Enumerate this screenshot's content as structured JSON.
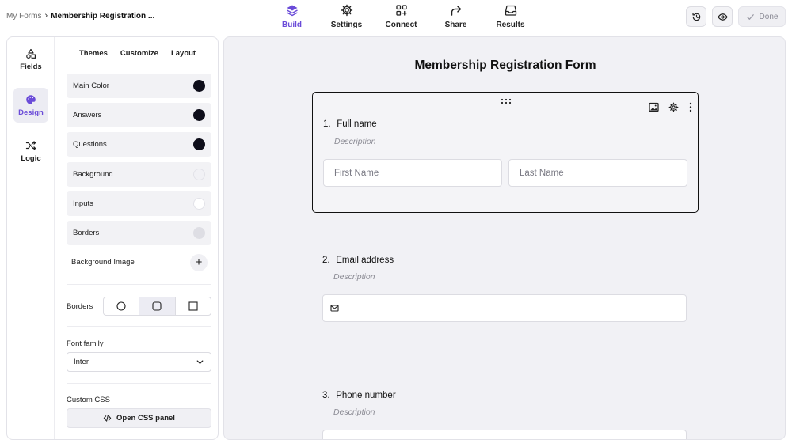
{
  "breadcrumb": {
    "root": "My Forms",
    "separator": "›",
    "current": "Membership Registration ..."
  },
  "nav": [
    {
      "label": "Build",
      "icon": "layers-icon",
      "active": true
    },
    {
      "label": "Settings",
      "icon": "gear-icon",
      "active": false
    },
    {
      "label": "Connect",
      "icon": "connect-icon",
      "active": false
    },
    {
      "label": "Share",
      "icon": "share-icon",
      "active": false
    },
    {
      "label": "Results",
      "icon": "inbox-icon",
      "active": false
    }
  ],
  "toolbar": {
    "history_icon": "history-icon",
    "preview_icon": "eye-icon",
    "done_label": "Done"
  },
  "rail": [
    {
      "label": "Fields",
      "icon": "shapes-icon",
      "active": false
    },
    {
      "label": "Design",
      "icon": "palette-icon",
      "active": true
    },
    {
      "label": "Logic",
      "icon": "shuffle-icon",
      "active": false
    }
  ],
  "subtabs": [
    {
      "label": "Themes",
      "active": false
    },
    {
      "label": "Customize",
      "active": true
    },
    {
      "label": "Layout",
      "active": false
    }
  ],
  "colors": [
    {
      "label": "Main Color",
      "value": "#0e0e1a"
    },
    {
      "label": "Answers",
      "value": "#0e0e1a"
    },
    {
      "label": "Questions",
      "value": "#0e0e1a"
    },
    {
      "label": "Background",
      "value": "#f1f1f5"
    },
    {
      "label": "Inputs",
      "value": "#ffffff"
    },
    {
      "label": "Borders",
      "value": "#dedee4"
    }
  ],
  "background_image": {
    "label": "Background Image",
    "add": "+"
  },
  "borders": {
    "label": "Borders",
    "options": [
      "rounded-full",
      "rounded",
      "square"
    ],
    "selected": "rounded"
  },
  "font": {
    "label": "Font family",
    "value": "Inter"
  },
  "css": {
    "label": "Custom CSS",
    "button": "Open CSS panel"
  },
  "form": {
    "title": "Membership Registration Form",
    "questions": [
      {
        "number": "1.",
        "title": "Full name",
        "description": "Description",
        "inputs": [
          "First Name",
          "Last Name"
        ]
      },
      {
        "number": "2.",
        "title": "Email address",
        "description": "Description",
        "inputs": [
          ""
        ]
      },
      {
        "number": "3.",
        "title": "Phone number",
        "description": "Description",
        "inputs": [
          ""
        ]
      }
    ]
  },
  "accent": "#6a4bd8"
}
